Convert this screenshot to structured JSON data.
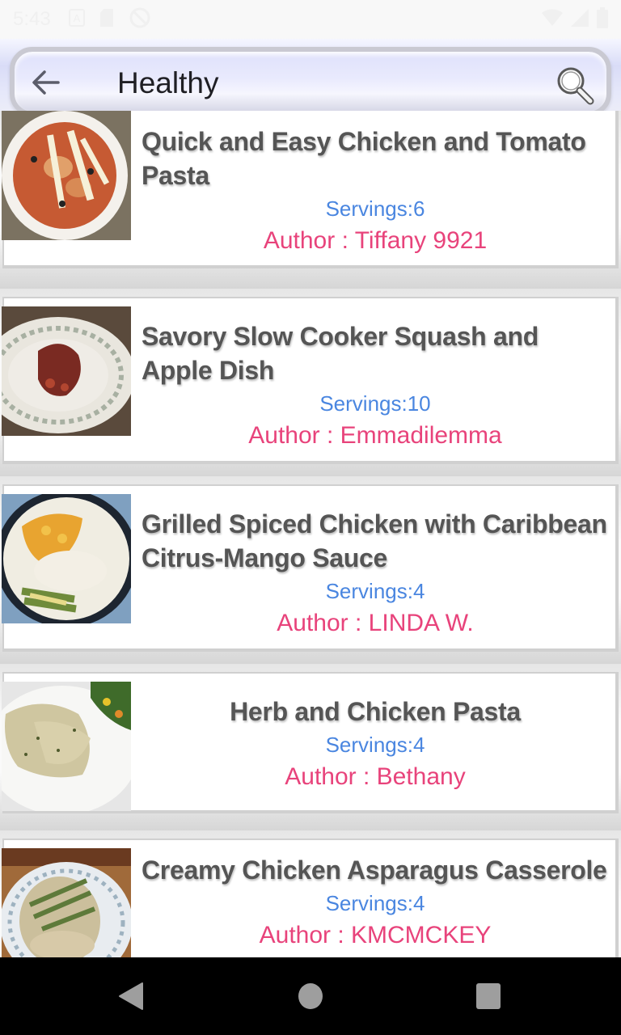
{
  "status_bar": {
    "time": "5:43",
    "icons": [
      "notification-a-icon",
      "sd-card-icon",
      "sync-disabled-icon"
    ],
    "right_icons": [
      "wifi-icon",
      "cell-signal-icon",
      "battery-icon"
    ]
  },
  "header": {
    "back_icon": "arrow-left-icon",
    "title": "Healthy",
    "search_icon": "magnifier-icon"
  },
  "recipes": [
    {
      "title": "Quick and Easy Chicken and Tomato Pasta",
      "servings": "Servings:6",
      "author": "Author : Tiffany 9921",
      "image": "bowl of chicken tomato pasta with shaved parmesan"
    },
    {
      "title": "Savory Slow Cooker Squash and Apple Dish",
      "servings": "Servings:10",
      "author": "Author : Emmadilemma",
      "image": "plate with red-brown squash and apple dish"
    },
    {
      "title": "Grilled Spiced Chicken with Caribbean Citrus-Mango Sauce",
      "servings": "Servings:4",
      "author": "Author : LINDA W.",
      "image": "plate with chicken, mango sauce, rice and asparagus"
    },
    {
      "title": "Herb and Chicken Pasta",
      "servings": "Servings:4",
      "author": "Author : Bethany",
      "image": "plate of herbed chicken with pasta and mixed vegetables"
    },
    {
      "title": "Creamy Chicken Asparagus Casserole",
      "servings": "Servings:4",
      "author": "Author : KMCMCKEY",
      "image": "plate of chicken asparagus casserole over rice"
    }
  ],
  "nav_bar": {
    "back": "nav-back-icon",
    "home": "nav-home-icon",
    "recents": "nav-recents-icon"
  },
  "colors": {
    "servings": "#4a86e0",
    "author": "#e8437b",
    "title": "#555555"
  }
}
